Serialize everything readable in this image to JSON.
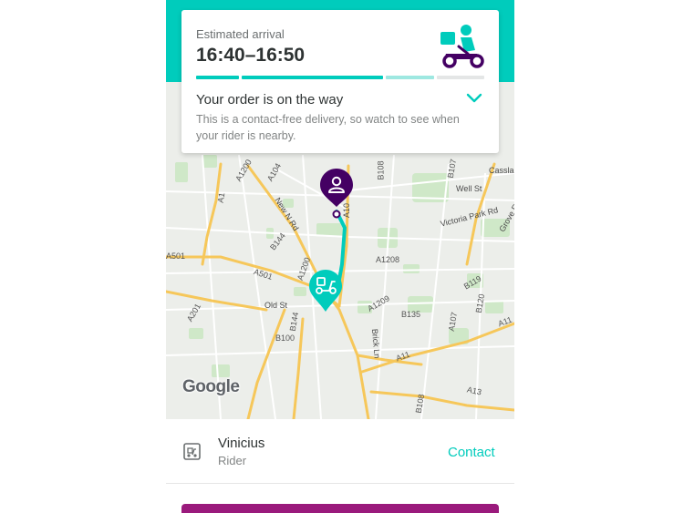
{
  "header": {
    "eta_label": "Estimated arrival",
    "eta_time": "16:40–16:50",
    "status_title": "Your order is on the way",
    "status_desc": "This is a contact-free delivery, so watch to see when your rider is nearby.",
    "progress_fraction": 0.75
  },
  "colors": {
    "brand_teal": "#00ccbc",
    "pin_purple": "#440063",
    "button_magenta": "#9a1a7c"
  },
  "map": {
    "labels": [
      "A1200",
      "A104",
      "B108",
      "B107",
      "Cassla",
      "A1",
      "New N Rd",
      "Well St",
      "Victoria Park Rd",
      "Grove Rd",
      "B144",
      "A10",
      "A501",
      "A1200",
      "A1208",
      "B119",
      "Old St",
      "A1209",
      "B120",
      "A201",
      "B144",
      "B135",
      "A107",
      "A11",
      "B100",
      "Brick Ln",
      "A11",
      "A13",
      "B108",
      "A501"
    ],
    "google_label": "Google"
  },
  "rider": {
    "name": "Vinicius",
    "role": "Rider",
    "contact_label": "Contact"
  }
}
